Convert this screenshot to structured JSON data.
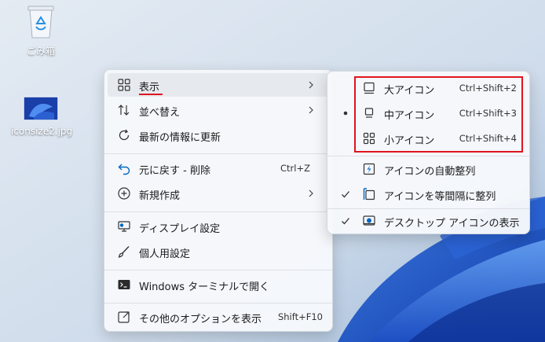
{
  "desktop": {
    "icons": [
      {
        "label": "ごみ箱",
        "icon": "recycle-bin-icon"
      },
      {
        "label": "iconsize2.jpg",
        "icon": "image-file-icon"
      }
    ]
  },
  "context_menu": {
    "items": [
      {
        "label": "表示",
        "icon": "grid-icon",
        "has_submenu": true
      },
      {
        "label": "並べ替え",
        "icon": "sort-icon",
        "has_submenu": true
      },
      {
        "label": "最新の情報に更新",
        "icon": "refresh-icon"
      },
      {
        "label": "元に戻す - 削除",
        "icon": "undo-icon",
        "shortcut": "Ctrl+Z"
      },
      {
        "label": "新規作成",
        "icon": "new-icon",
        "has_submenu": true
      },
      {
        "label": "ディスプレイ設定",
        "icon": "display-settings-icon"
      },
      {
        "label": "個人用設定",
        "icon": "brush-icon"
      },
      {
        "label": "Windows ターミナルで開く",
        "icon": "terminal-icon"
      },
      {
        "label": "その他のオプションを表示",
        "icon": "more-options-icon",
        "shortcut": "Shift+F10"
      }
    ]
  },
  "view_submenu": {
    "items": [
      {
        "label": "大アイコン",
        "icon": "large-icon-icon",
        "shortcut": "Ctrl+Shift+2"
      },
      {
        "label": "中アイコン",
        "icon": "medium-icon-icon",
        "shortcut": "Ctrl+Shift+3",
        "mark": "bullet"
      },
      {
        "label": "小アイコン",
        "icon": "small-icon-icon",
        "shortcut": "Ctrl+Shift+4"
      },
      {
        "label": "アイコンの自動整列",
        "icon": "auto-arrange-icon"
      },
      {
        "label": "アイコンを等間隔に整列",
        "icon": "align-grid-icon",
        "mark": "check"
      },
      {
        "label": "デスクトップ アイコンの表示",
        "icon": "show-desktop-icons-icon",
        "mark": "check"
      }
    ]
  },
  "colors": {
    "accent_red": "#e0141e",
    "menu_bg": "#f6f8fb",
    "icon_blue": "#0067c0"
  }
}
